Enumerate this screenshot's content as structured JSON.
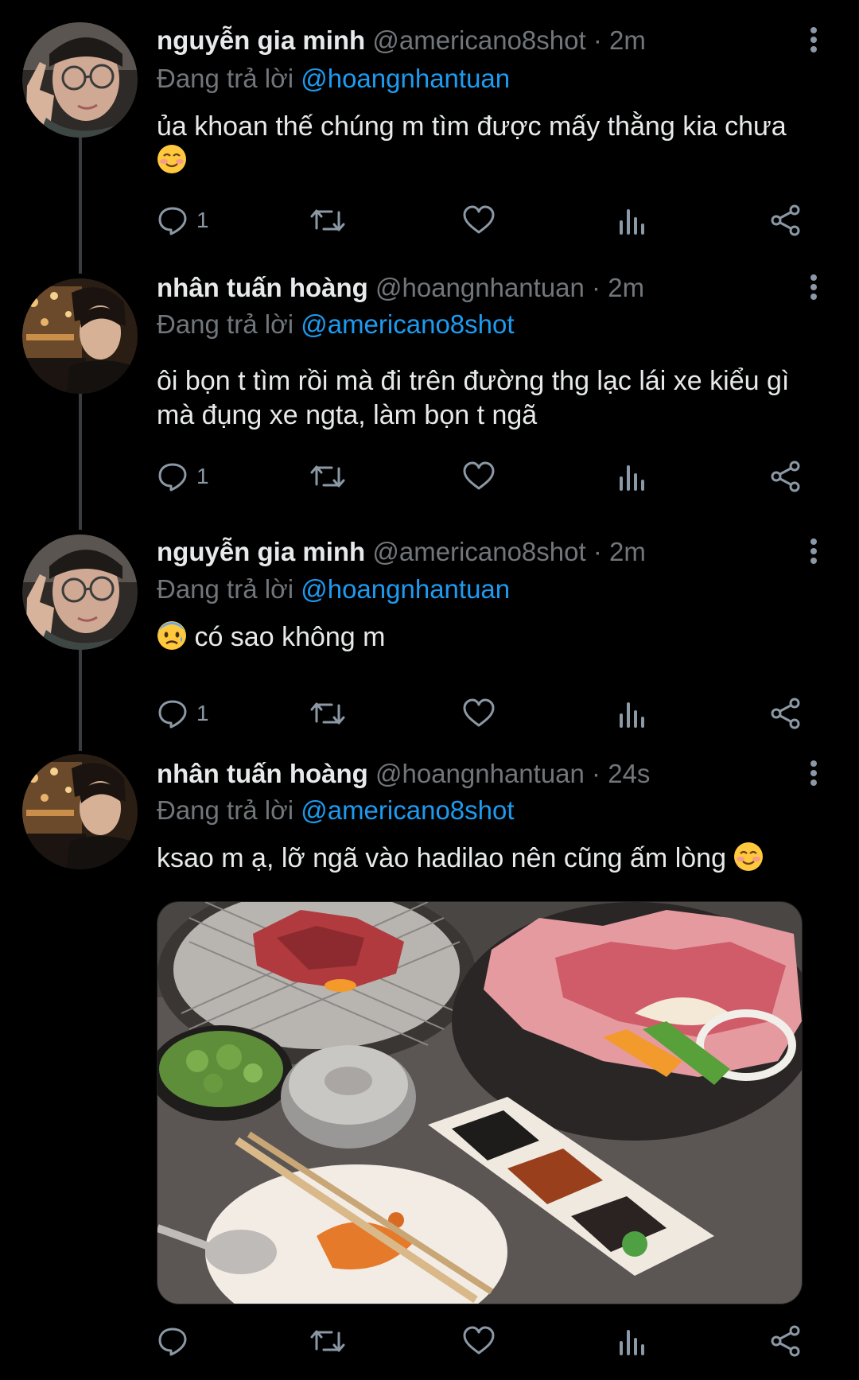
{
  "tweets": [
    {
      "display_name": "nguyễn gia minh",
      "meta": "@americano8shot · 2m",
      "reply_prefix": "Đang trả lời",
      "reply_to": "@hoangnhantuan",
      "text": "ủa khoan thế chúng m tìm được mấy thằng kia chưa",
      "trailing_emoji": "☺️",
      "reply_count": "1",
      "avatar": "avatar-glasses"
    },
    {
      "display_name": "nhân tuấn hoàng",
      "meta": "@hoangnhantuan · 2m",
      "reply_prefix": "Đang trả lời",
      "reply_to": "@americano8shot",
      "text": "ôi bọn t tìm rồi mà đi trên đường thg lạc lái xe kiểu gì mà đụng xe ngta, làm bọn t ngã",
      "reply_count": "1",
      "avatar": "avatar-night-city"
    },
    {
      "display_name": "nguyễn gia minh",
      "meta": "@americano8shot · 2m",
      "reply_prefix": "Đang trả lời",
      "reply_to": "@hoangnhantuan",
      "leading_emoji": "😰",
      "text": "có sao không m",
      "reply_count": "1",
      "avatar": "avatar-glasses"
    },
    {
      "display_name": "nhân tuấn hoàng",
      "meta": "@hoangnhantuan · 24s",
      "reply_prefix": "Đang trả lời",
      "reply_to": "@americano8shot",
      "text": "ksao m ạ, lỡ ngã vào hadilao nên cũng ấm lòng",
      "trailing_emoji": "☺️",
      "reply_count": "",
      "avatar": "avatar-night-city",
      "media": "photo-korean-bbq"
    }
  ],
  "icons": {
    "more": "more-vertical-icon",
    "reply": "reply-icon",
    "retweet": "retweet-icon",
    "like": "heart-icon",
    "views": "analytics-icon",
    "share": "share-icon"
  },
  "colors": {
    "background": "#000000",
    "text": "#e7e9ea",
    "secondary": "#71767b",
    "link": "#1d9bf0",
    "thread_line": "#3a3d40"
  }
}
